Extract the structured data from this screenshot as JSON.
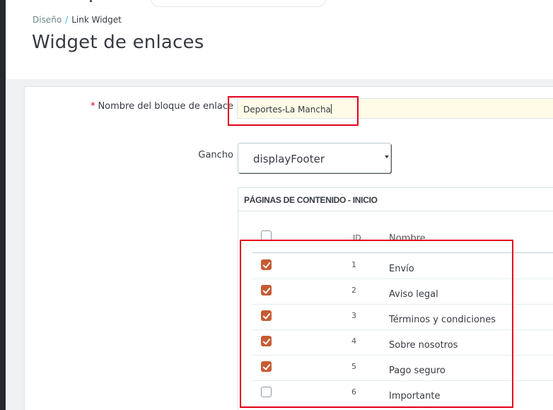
{
  "breadcrumb": {
    "parent": "Diseño",
    "separator": "/",
    "current": "Link Widget"
  },
  "page_title": "Widget de enlaces",
  "form": {
    "block_name": {
      "required_mark": "*",
      "label": "Nombre del bloque de enlace",
      "value": "Deportes-La Mancha"
    },
    "hook": {
      "label": "Gancho",
      "selected": "displayFooter"
    }
  },
  "cms_pages": {
    "heading": "PÁGINAS DE CONTENIDO - INICIO",
    "columns": {
      "id": "ID",
      "name": "Nombre"
    },
    "rows": [
      {
        "id": "1",
        "name": "Envío",
        "checked": true
      },
      {
        "id": "2",
        "name": "Aviso legal",
        "checked": true
      },
      {
        "id": "3",
        "name": "Términos y condiciones",
        "checked": true
      },
      {
        "id": "4",
        "name": "Sobre nosotros",
        "checked": true
      },
      {
        "id": "5",
        "name": "Pago seguro",
        "checked": true
      },
      {
        "id": "6",
        "name": "Importante",
        "checked": false
      }
    ]
  },
  "colors": {
    "highlight": "#e3001b",
    "checkbox_checked": "#c65b34",
    "required": "#e0001b",
    "input_bg": "#fffbe6"
  }
}
